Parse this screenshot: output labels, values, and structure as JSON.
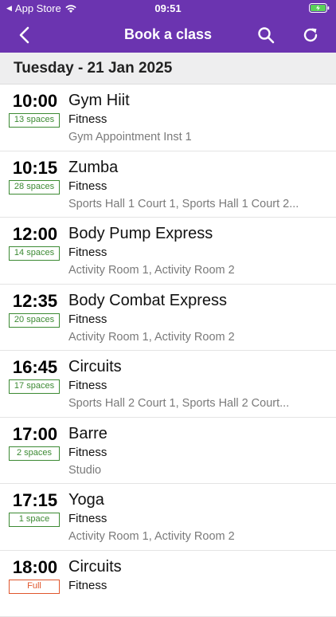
{
  "status_bar": {
    "carrier": "App Store",
    "time": "09:51"
  },
  "header": {
    "title": "Book a class",
    "back_icon": "chevron-left-icon",
    "search_icon": "search-icon",
    "refresh_icon": "refresh-icon"
  },
  "date_label": "Tuesday - 21 Jan 2025",
  "colors": {
    "brand": "#6b34b0",
    "spaces_green": "#3c8a33",
    "full_orange": "#e0562d"
  },
  "classes": [
    {
      "time": "10:00",
      "spaces": "13 spaces",
      "name": "Gym Hiit",
      "category": "Fitness",
      "location": "Gym Appointment Inst 1"
    },
    {
      "time": "10:15",
      "spaces": "28 spaces",
      "name": "Zumba",
      "category": "Fitness",
      "location": "Sports Hall 1 Court 1, Sports Hall 1 Court 2..."
    },
    {
      "time": "12:00",
      "spaces": "14 spaces",
      "name": "Body Pump Express",
      "category": "Fitness",
      "location": "Activity Room 1, Activity Room 2"
    },
    {
      "time": "12:35",
      "spaces": "20 spaces",
      "name": "Body Combat Express",
      "category": "Fitness",
      "location": "Activity Room 1, Activity Room 2"
    },
    {
      "time": "16:45",
      "spaces": "17 spaces",
      "name": "Circuits",
      "category": "Fitness",
      "location": "Sports Hall 2 Court 1, Sports Hall 2 Court..."
    },
    {
      "time": "17:00",
      "spaces": "2 spaces",
      "name": "Barre",
      "category": "Fitness",
      "location": "Studio"
    },
    {
      "time": "17:15",
      "spaces": "1 space",
      "name": "Yoga",
      "category": "Fitness",
      "location": "Activity Room 1, Activity Room 2"
    },
    {
      "time": "18:00",
      "spaces": "Full",
      "name": "Circuits",
      "category": "Fitness",
      "location": ""
    }
  ]
}
